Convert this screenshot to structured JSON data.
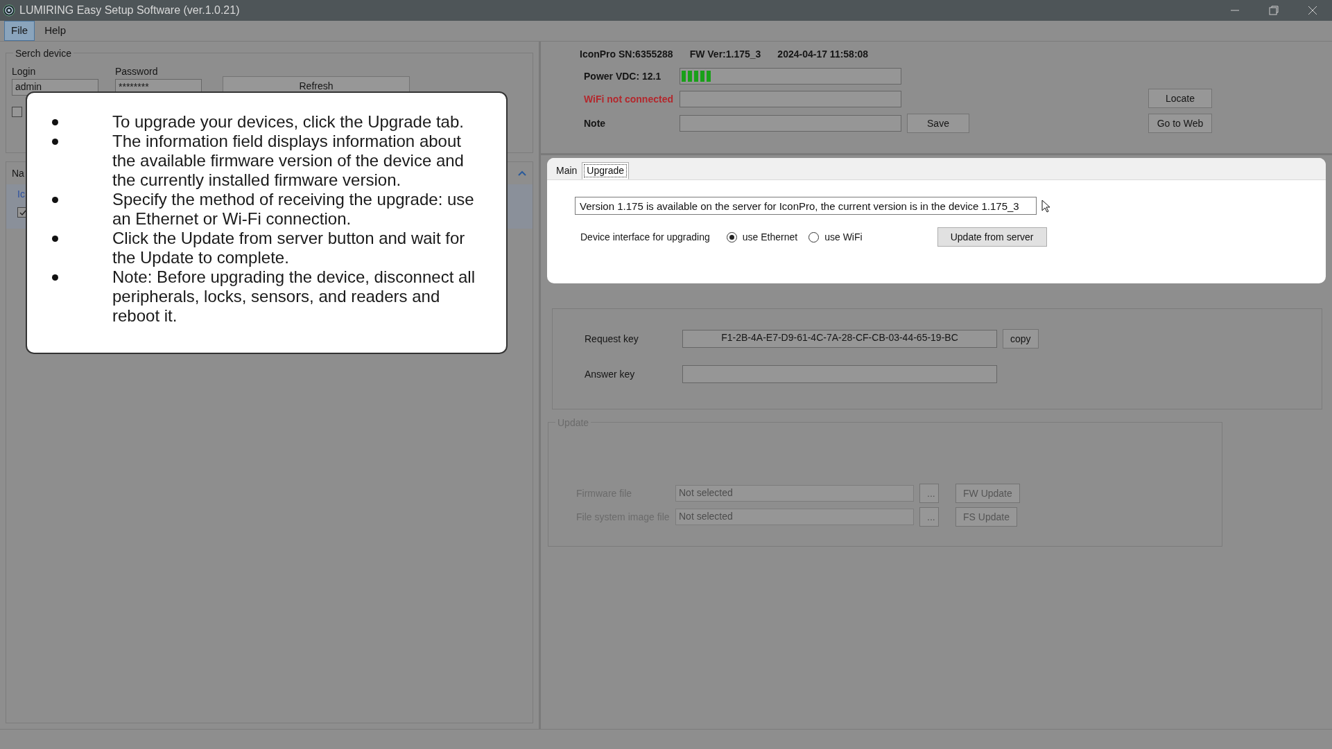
{
  "window": {
    "title": "LUMIRING Easy Setup Software (ver.1.0.21)"
  },
  "menu": [
    {
      "label": "File",
      "selected": true
    },
    {
      "label": "Help",
      "selected": false
    }
  ],
  "search_device": {
    "title": "Serch device",
    "login": {
      "label": "Login",
      "value": "admin"
    },
    "password": {
      "label": "Password",
      "value": "********"
    },
    "refresh": "Refresh",
    "checkbox": {
      "checked": false
    }
  },
  "device_list": {
    "header": "Na",
    "row_text": "Ic",
    "checkbox": {
      "checked": true
    }
  },
  "device": {
    "sn": "IconPro SN:6355288",
    "fw": "FW Ver:1.175_3",
    "datetime": "2024-04-17 11:58:08",
    "power": {
      "label": "Power VDC: 12.1",
      "level": 0.14
    },
    "wifi": {
      "label": "WiFi not connected",
      "connected": false
    },
    "note": {
      "label": "Note"
    },
    "save": "Save",
    "locate": "Locate",
    "go_to_web": "Go to Web"
  },
  "tabs": [
    {
      "label": "Main",
      "selected": false
    },
    {
      "label": "Upgrade",
      "selected": true
    }
  ],
  "upgrade": {
    "info": "Version 1.175 is available on the server for IconPro, the current version is in the device 1.175_3",
    "interface_label": "Device interface for upgrading",
    "options": [
      {
        "label": "use Ethernet",
        "selected": true
      },
      {
        "label": "use WiFi",
        "selected": false
      }
    ],
    "update_button": "Update from server"
  },
  "keys": {
    "request": {
      "label": "Request key",
      "value": "F1-2B-4A-E7-D9-61-4C-7A-28-CF-CB-03-44-65-19-BC"
    },
    "copy": "copy",
    "answer": {
      "label": "Answer key"
    }
  },
  "update": {
    "title": "Update",
    "disabled": true,
    "rows": [
      {
        "label": "Firmware file",
        "value": "Not selected",
        "browse": "...",
        "button": "FW Update"
      },
      {
        "label": "File system image file",
        "value": "Not selected",
        "browse": "...",
        "button": "FS Update"
      }
    ]
  },
  "callout": {
    "items": [
      "To upgrade your devices, click the Upgrade tab.",
      "The information field displays information about the available firmware version of the device and the currently installed firmware version.",
      "Specify the method of receiving the upgrade: use an Ethernet or Wi-Fi connection.",
      "Click the Update from server button and wait for the Update to complete.",
      "Note: Before upgrading the device, disconnect all peripherals, locks, sensors, and readers and reboot it."
    ]
  }
}
